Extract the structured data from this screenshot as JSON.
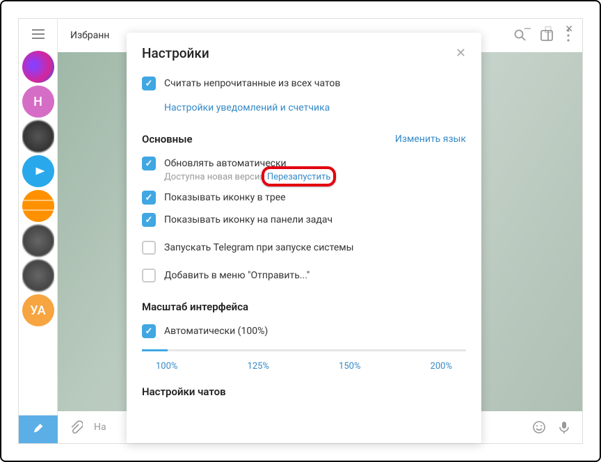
{
  "window": {
    "chat_title": "Избранн",
    "msg_placeholder": "На"
  },
  "sidebar": {
    "avatars": [
      {
        "letter": ""
      },
      {
        "letter": "Н"
      },
      {
        "letter": ""
      },
      {
        "letter": ""
      },
      {
        "letter": ""
      },
      {
        "letter": ""
      },
      {
        "letter": ""
      },
      {
        "letter": "УА"
      }
    ]
  },
  "modal": {
    "title": "Настройки",
    "top_checkbox": "Считать непрочитанные из всех чатов",
    "notif_link": "Настройки уведомлений и счетчика",
    "basic": {
      "title": "Основные",
      "change_lang": "Изменить язык",
      "auto_update": "Обновлять автоматически",
      "update_avail": "Доступна новая версия",
      "restart": "Перезапустить",
      "tray_icon": "Показывать иконку в трее",
      "taskbar_icon": "Показывать иконку на панели задач",
      "autorun": "Запускать Telegram при запуске системы",
      "sendto": "Добавить в меню \"Отправить...\""
    },
    "scale": {
      "title": "Масштаб интерфейса",
      "auto": "Автоматически (100%)",
      "ticks": [
        "100%",
        "125%",
        "150%",
        "200%"
      ]
    },
    "chats_title": "Настройки чатов"
  }
}
